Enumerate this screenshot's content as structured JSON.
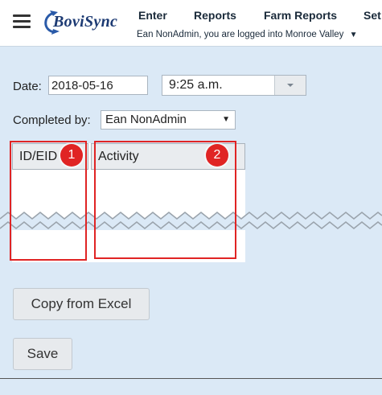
{
  "header": {
    "logo_text": "BoviSync",
    "nav": [
      "Enter",
      "Reports",
      "Farm Reports",
      "Set"
    ],
    "login_text": "Ean NonAdmin, you are logged into Monroe Valley",
    "login_caret": "▼"
  },
  "form": {
    "date_label": "Date:",
    "date_value": "2018-05-16",
    "time_value": "9:25 a.m.",
    "completed_by_label": "Completed by:",
    "completed_by_value": "Ean NonAdmin",
    "select_arrow": "▼"
  },
  "table": {
    "columns": [
      "ID/EID",
      "Activity"
    ]
  },
  "annotations": {
    "badges": [
      "1",
      "2"
    ],
    "color": "#e02424"
  },
  "buttons": {
    "copy_from_excel": "Copy from Excel",
    "save": "Save"
  },
  "colors": {
    "background": "#dbe9f6",
    "logo": "#1c3a73"
  }
}
